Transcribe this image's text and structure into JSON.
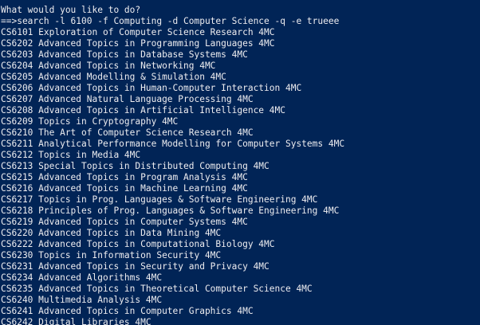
{
  "console": {
    "prompt": "What would you like to do?",
    "command": "==>search -l 6100 -f Computing -d Computer Science -q -e trueee"
  },
  "results": [
    "CS6101 Exploration of Computer Science Research 4MC",
    "CS6202 Advanced Topics in Programming Languages 4MC",
    "CS6203 Advanced Topics in Database Systems 4MC",
    "CS6204 Advanced Topics in Networking 4MC",
    "CS6205 Advanced Modelling & Simulation 4MC",
    "CS6206 Advanced Topics in Human-Computer Interaction 4MC",
    "CS6207 Advanced Natural Language Processing 4MC",
    "CS6208 Advanced Topics in Artificial Intelligence 4MC",
    "CS6209 Topics in Cryptography 4MC",
    "CS6210 The Art of Computer Science Research 4MC",
    "CS6211 Analytical Performance Modelling for Computer Systems 4MC",
    "CS6212 Topics in Media 4MC",
    "CS6213 Special Topics in Distributed Computing 4MC",
    "CS6215 Advanced Topics in Program Analysis 4MC",
    "CS6216 Advanced Topics in Machine Learning 4MC",
    "CS6217 Topics in Prog. Languages & Software Engineering 4MC",
    "CS6218 Principles of Prog. Languages & Software Engineering 4MC",
    "CS6219 Advanced Topics in Computer Systems 4MC",
    "CS6220 Advanced Topics in Data Mining 4MC",
    "CS6222 Advanced Topics in Computational Biology 4MC",
    "CS6230 Topics in Information Security 4MC",
    "CS6231 Advanced Topics in Security and Privacy 4MC",
    "CS6234 Advanced Algorithms 4MC",
    "CS6235 Advanced Topics in Theoretical Computer Science 4MC",
    "CS6240 Multimedia Analysis 4MC",
    "CS6241 Advanced Topics in Computer Graphics 4MC",
    "CS6242 Digital Libraries 4MC"
  ],
  "colors": {
    "background": "#012456",
    "foreground": "#eeedf0"
  }
}
